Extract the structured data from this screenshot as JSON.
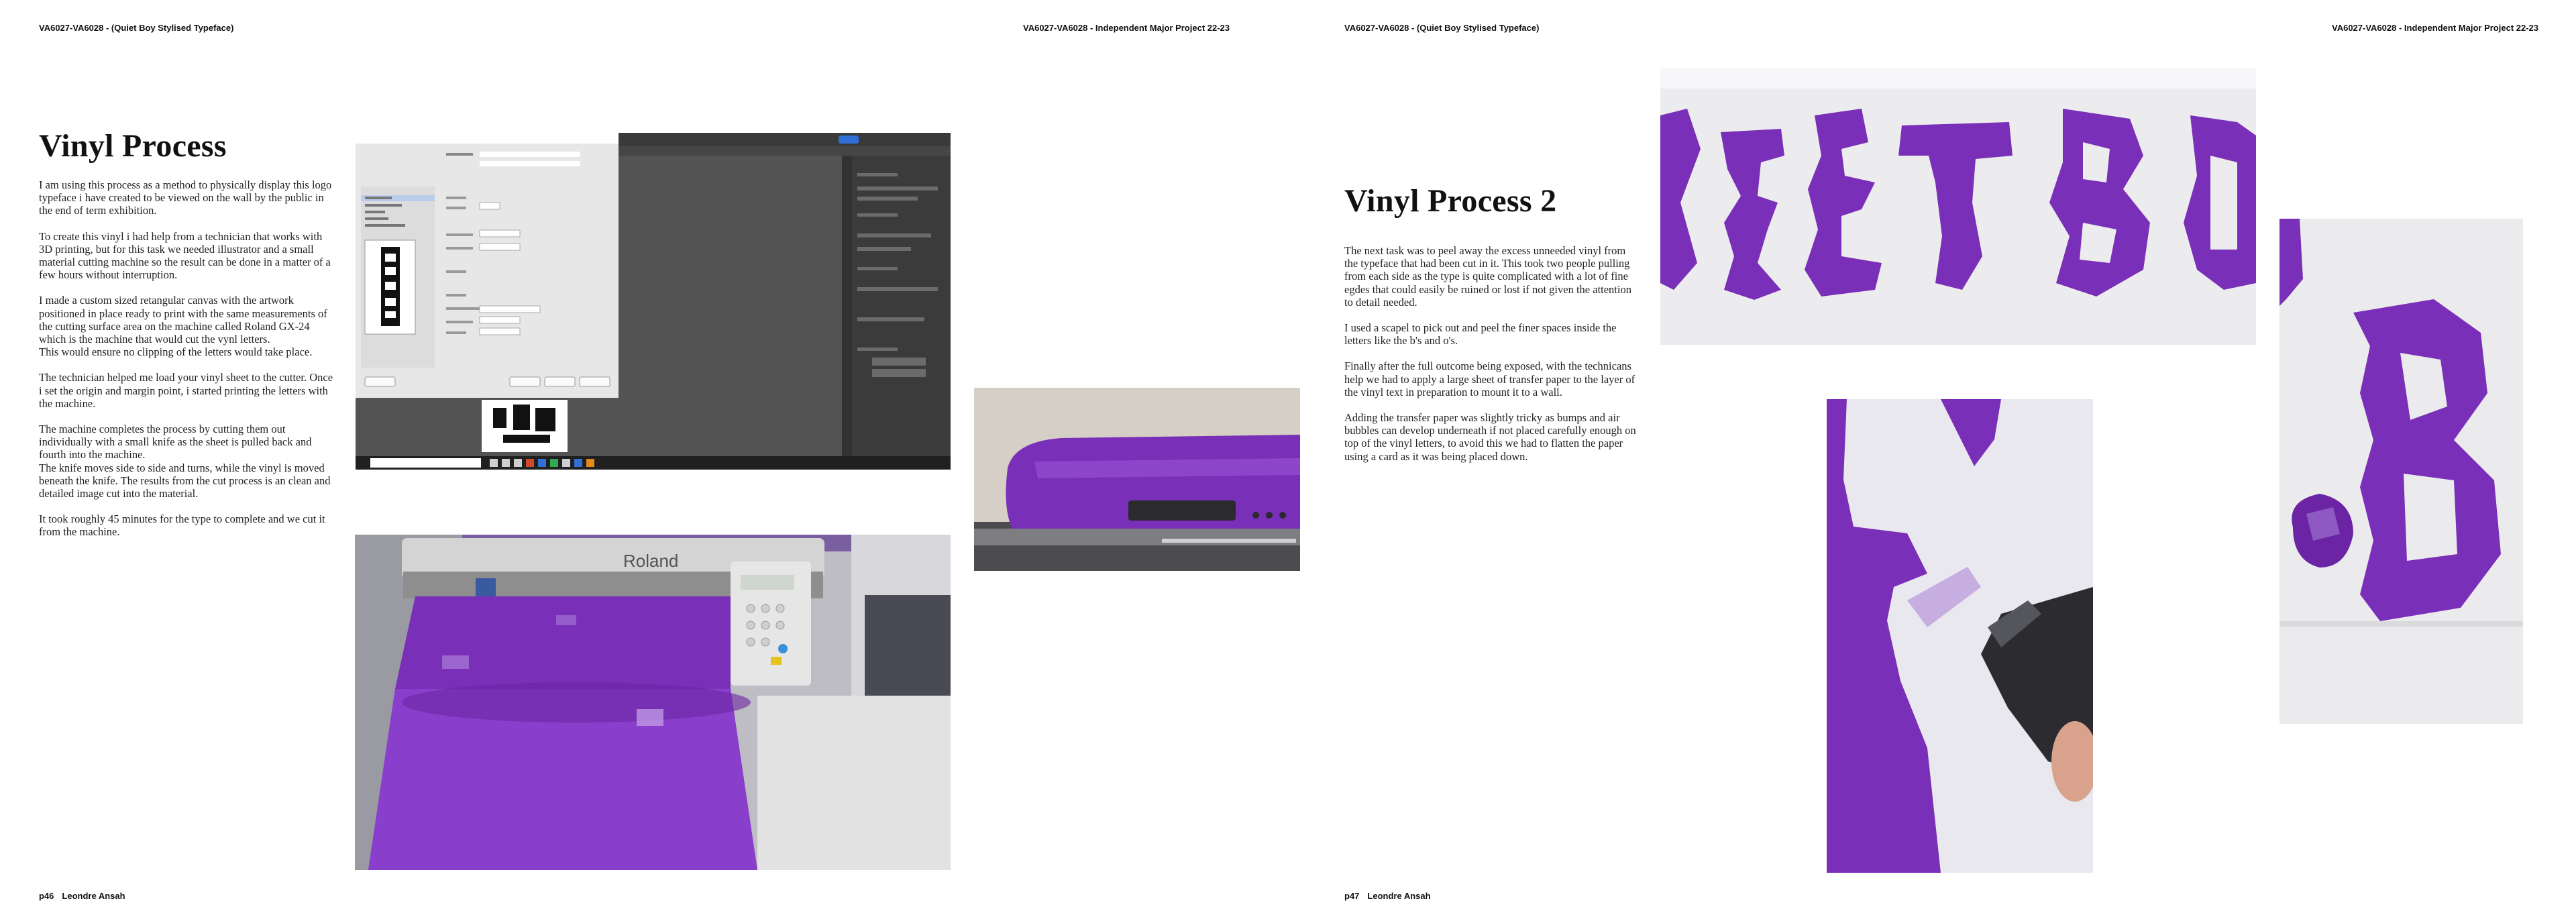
{
  "left_page": {
    "header_left": "VA6027-VA6028 - (Quiet Boy Stylised Typeface)",
    "header_right": "VA6027-VA6028 - Independent Major Project 22-23",
    "title": "Vinyl Process",
    "paragraphs": [
      "I am using this process as a method to physically display this logo typeface i have created to be viewed on the wall by the public in the end of term exhibition.",
      "To create this vinyl i had help from a technician that works with 3D printing, but for this task we needed illustrator and a small material cutting machine so the result can be done in a matter of a few hours without interruption.",
      "I made a custom sized retangular canvas with the artwork positioned in place ready to print with the same measurements of the cutting surface area on the machine called Roland GX-24 which is the machine that would cut the vynl letters.\nThis would ensure no clipping of the letters would take place.",
      "The technician helped me load your vinyl sheet to the cutter. Once i set the origin and margin point, i started printing the letters with the machine.",
      "The machine completes the process by cutting them out individually with a small knife as the sheet is pulled back and fourth into the machine.\nThe knife moves side to side and turns, while the vinyl is moved beneath the knife. The results from the cut process is an clean and detailed image cut into the material.",
      "It took roughly 45 minutes for the type to complete and we cut it from the machine."
    ],
    "page_number": "p46",
    "author": "Leondre Ansah"
  },
  "right_page": {
    "header_left": "VA6027-VA6028 - (Quiet Boy Stylised Typeface)",
    "header_right": "VA6027-VA6028 - Independent Major Project 22-23",
    "title": "Vinyl Process 2",
    "paragraphs": [
      "The next task was to peel away the excess unneeded vinyl from the typeface that had been cut in it. This took two people pulling from each side as the type is quite complicated with a lot of fine egdes that could easily be ruined or lost if not given the attention to detail needed.",
      "I used a scapel to pick out  and peel the finer spaces inside the letters like the b's and o's.",
      "Finally after the full outcome being exposed, with the technicans help we had to apply a large sheet of transfer paper to the layer of the vinyl text in preparation to mount it to a wall.",
      "Adding the transfer paper was slightly tricky as bumps and air bubbles can develop underneath if not placed carefully enough on top of the vinyl letters, to avoid this we had to flatten the paper using a card as it was being placed down."
    ],
    "page_number": "p47",
    "author": "Leondre Ansah"
  },
  "screenshot_labels": {
    "dialog_buttons": [
      "Setup...",
      "Done",
      "Print",
      "Cancel"
    ],
    "dialog_sidebar": [
      "General",
      "Marks and Bleed",
      "Output",
      "Graphics",
      "Color Management",
      "Advanced",
      "Summary"
    ],
    "search_placeholder": "Type here to search",
    "panel_tab": "Properties"
  },
  "machine_label": "Roland",
  "colors": {
    "vinyl_purple": "#7a2fb8",
    "page_bg": "#ffffff",
    "text": "#1a1a1a"
  }
}
